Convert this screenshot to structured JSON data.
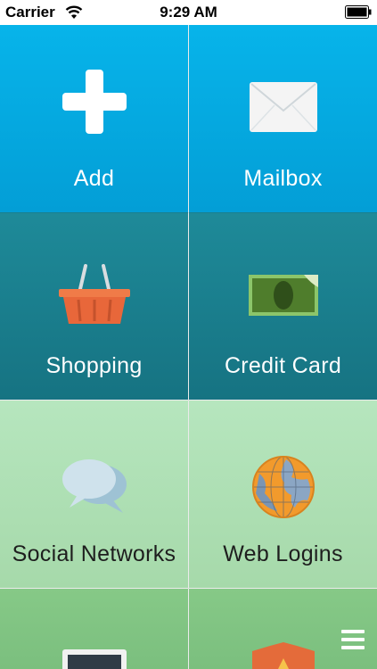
{
  "status_bar": {
    "carrier": "Carrier",
    "time": "9:29 AM"
  },
  "tiles": [
    {
      "label": "Add",
      "icon": "plus-icon"
    },
    {
      "label": "Mailbox",
      "icon": "envelope-icon"
    },
    {
      "label": "Shopping",
      "icon": "shopping-basket-icon"
    },
    {
      "label": "Credit Card",
      "icon": "money-bill-icon"
    },
    {
      "label": "Social Networks",
      "icon": "speech-bubbles-icon"
    },
    {
      "label": "Web Logins",
      "icon": "globe-icon"
    },
    {
      "label": "",
      "icon": "computer-icon"
    },
    {
      "label": "",
      "icon": "shield-icon"
    }
  ],
  "colors": {
    "row1": "#039ed6",
    "row2": "#167382",
    "row3": "#a6d9aa",
    "row4": "#7bbf7e"
  },
  "menu_button": {
    "icon": "menu-icon"
  }
}
